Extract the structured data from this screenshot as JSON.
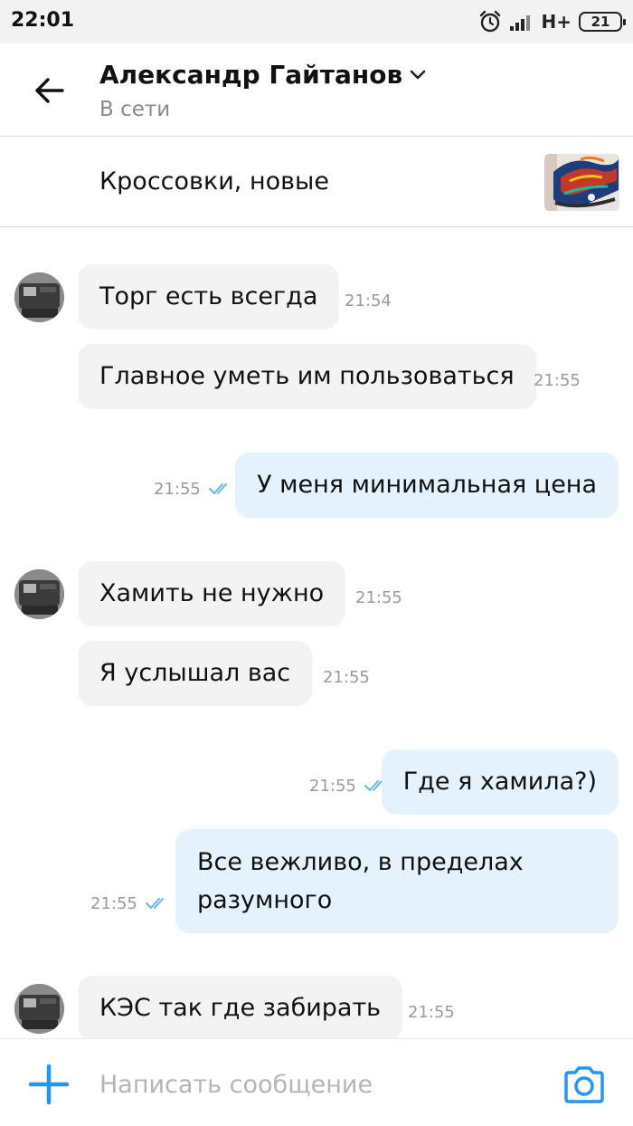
{
  "status_bar": {
    "time": "22:01",
    "network": "H+",
    "battery": "21",
    "icons": [
      "alarm-icon",
      "signal-icon",
      "battery-icon"
    ]
  },
  "header": {
    "contact_name": "Александр Гайтанов",
    "contact_status": "В сети",
    "icons": [
      "back-arrow-icon",
      "chevron-down-icon"
    ]
  },
  "listing": {
    "title": "Кроссовки, новые"
  },
  "messages": [
    {
      "direction": "in",
      "text": "Торг есть всегда",
      "time": "21:54"
    },
    {
      "direction": "in",
      "text": "Главное уметь им пользоваться",
      "time": "21:55"
    },
    {
      "direction": "out",
      "text": "У меня минимальная цена",
      "time": "21:55",
      "read": true
    },
    {
      "direction": "in",
      "text": "Хамить не нужно",
      "time": "21:55"
    },
    {
      "direction": "in",
      "text": "Я услышал вас",
      "time": "21:55"
    },
    {
      "direction": "out",
      "text": "Где я хамила?)",
      "time": "21:55",
      "read": true
    },
    {
      "direction": "out",
      "text": "Все вежливо, в пределах разумного",
      "time": "21:55",
      "read": true
    },
    {
      "direction": "in",
      "text": "КЭС так где забирать",
      "time": "21:55"
    }
  ],
  "composer": {
    "placeholder": "Написать сообщение",
    "icons": [
      "plus-icon",
      "camera-icon"
    ]
  },
  "colors": {
    "accent": "#2196f3",
    "incoming_bubble": "#f3f3f3",
    "outgoing_bubble": "#e3f2fc",
    "read_check": "#64b5f6"
  }
}
